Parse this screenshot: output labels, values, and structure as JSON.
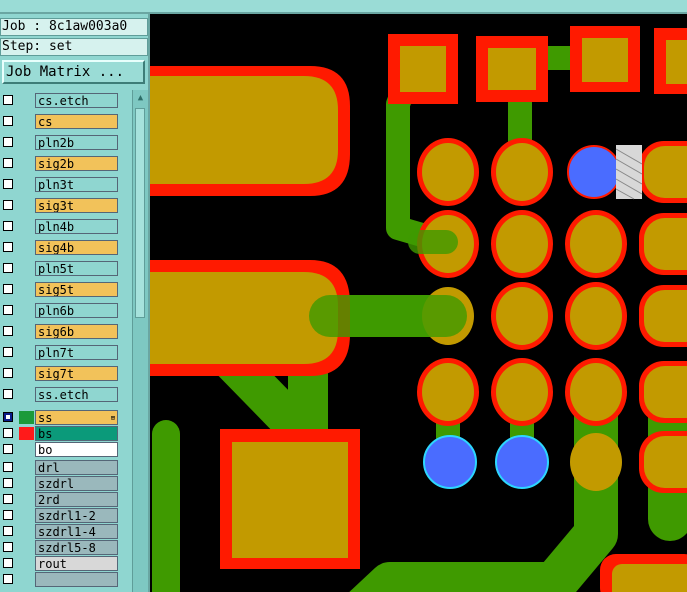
{
  "job_label": "Job : 8c1aw003a0",
  "step_label": "Step: set",
  "job_matrix_button": "Job Matrix ...",
  "layers": [
    {
      "name": "cs.etch",
      "color": "#8fd6d0",
      "checked": false
    },
    {
      "name": "cs",
      "color": "#f2c25a",
      "checked": false
    },
    {
      "name": "pln2b",
      "color": "#8fd6d0",
      "checked": false
    },
    {
      "name": "sig2b",
      "color": "#f2c25a",
      "checked": false
    },
    {
      "name": "pln3t",
      "color": "#8fd6d0",
      "checked": false
    },
    {
      "name": "sig3t",
      "color": "#f2c25a",
      "checked": false
    },
    {
      "name": "pln4b",
      "color": "#8fd6d0",
      "checked": false
    },
    {
      "name": "sig4b",
      "color": "#f2c25a",
      "checked": false
    },
    {
      "name": "pln5t",
      "color": "#8fd6d0",
      "checked": false
    },
    {
      "name": "sig5t",
      "color": "#f2c25a",
      "checked": false
    },
    {
      "name": "pln6b",
      "color": "#8fd6d0",
      "checked": false
    },
    {
      "name": "sig6b",
      "color": "#f2c25a",
      "checked": false
    },
    {
      "name": "pln7t",
      "color": "#8fd6d0",
      "checked": false
    },
    {
      "name": "sig7t",
      "color": "#f2c25a",
      "checked": false
    },
    {
      "name": "ss.etch",
      "color": "#8fd6d0",
      "checked": false
    },
    {
      "name": "ss",
      "color": "#f2c25a",
      "checked": true,
      "swatch": "#1a9a3a"
    },
    {
      "name": "bs",
      "color": "#0b9a7a",
      "checked": false,
      "swatch": "#ff1a1a"
    },
    {
      "name": "bo",
      "color": "#ffffff",
      "checked": false
    },
    {
      "name": "drl",
      "color": "#9ab8bc",
      "checked": false
    },
    {
      "name": "szdrl",
      "color": "#9ab8bc",
      "checked": false
    },
    {
      "name": "2rd",
      "color": "#9ab8bc",
      "checked": false
    },
    {
      "name": "szdrl1-2",
      "color": "#9ab8bc",
      "checked": false
    },
    {
      "name": "szdrl1-4",
      "color": "#9ab8bc",
      "checked": false
    },
    {
      "name": "szdrl5-8",
      "color": "#9ab8bc",
      "checked": false
    },
    {
      "name": "rout",
      "color": "#d8d8d8",
      "checked": false
    },
    {
      "name": "",
      "color": "#9ab8bc",
      "checked": false
    }
  ],
  "colors": {
    "copper": "#c29a00",
    "solder_mask": "#ff1a00",
    "trace": "#3f9a00",
    "via": "#4a6cff",
    "background": "#000000"
  },
  "icons": {
    "scroll_up": "triangle-up"
  }
}
